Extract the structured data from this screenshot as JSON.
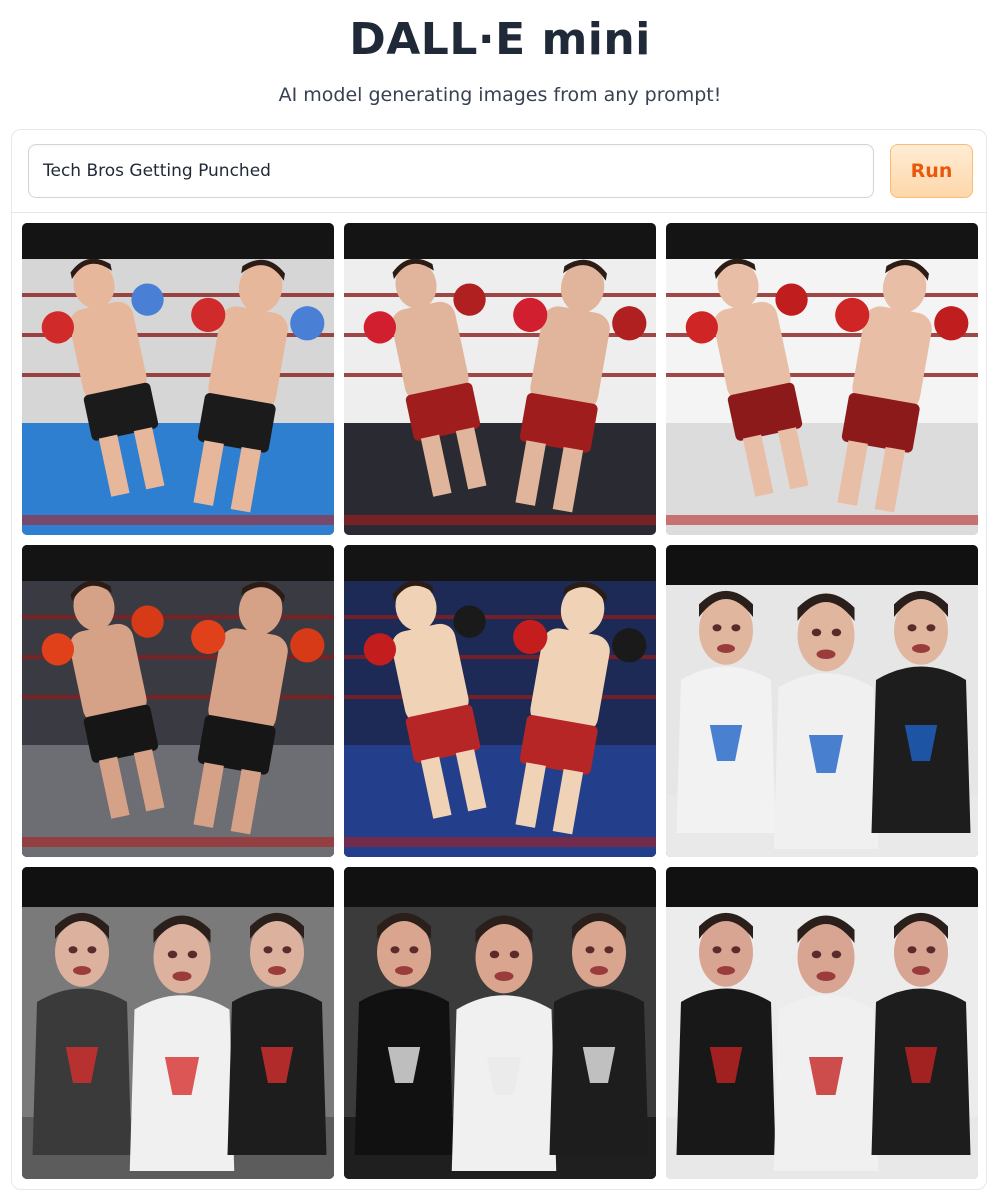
{
  "header": {
    "title": "DALL·E mini",
    "subtitle": "AI model generating images from any prompt!"
  },
  "prompt": {
    "value": "Tech Bros Getting Punched",
    "run_label": "Run"
  },
  "gallery": {
    "images": [
      {
        "scene": "boxing-ring",
        "floor": "#2f7fd0",
        "glove": "#d12a2a",
        "glove2": "#4a7fd6",
        "shorts": "#1b1b1b",
        "skin": "#e6b79a",
        "bg": "#d6d6d6"
      },
      {
        "scene": "boxing-ring",
        "floor": "#2a2a33",
        "glove": "#d21f2f",
        "glove2": "#b02020",
        "shorts": "#a01d1d",
        "skin": "#e0b59b",
        "bg": "#eeeeee"
      },
      {
        "scene": "boxing-ring",
        "floor": "#dcdcdc",
        "glove": "#d02525",
        "glove2": "#c01e1e",
        "shorts": "#8d1a1a",
        "skin": "#e8bfa6",
        "bg": "#f4f4f4"
      },
      {
        "scene": "boxing-ring",
        "floor": "#6d6d74",
        "glove": "#e0401a",
        "glove2": "#d63a17",
        "shorts": "#161616",
        "skin": "#d5a187",
        "bg": "#3a3a42"
      },
      {
        "scene": "boxing-ring",
        "floor": "#233e8a",
        "glove": "#c41d1d",
        "glove2": "#1a1a1a",
        "shorts": "#b62626",
        "skin": "#f0d2b6",
        "bg": "#1d2a55"
      },
      {
        "scene": "group-portrait",
        "floor": "#e9e9e9",
        "glove": "#d22a2a",
        "glove2": "#1f63c7",
        "shorts": "#f2f2f2",
        "skin": "#e1b69f",
        "bg": "#e6e6e6"
      },
      {
        "scene": "group-portrait",
        "floor": "#5c5c5c",
        "glove": "#2b2b2b",
        "glove2": "#d83030",
        "shorts": "#3a3a3a",
        "skin": "#dcb19d",
        "bg": "#7a7a7a"
      },
      {
        "scene": "group-portrait",
        "floor": "#1f1f1f",
        "glove": "#111111",
        "glove2": "#eaeaea",
        "shorts": "#111111",
        "skin": "#d9a58e",
        "bg": "#3b3b3b"
      },
      {
        "scene": "group-portrait",
        "floor": "#e8e8e8",
        "glove": "#1a1a1a",
        "glove2": "#c42424",
        "shorts": "#181818",
        "skin": "#d8a592",
        "bg": "#ececec"
      }
    ]
  }
}
